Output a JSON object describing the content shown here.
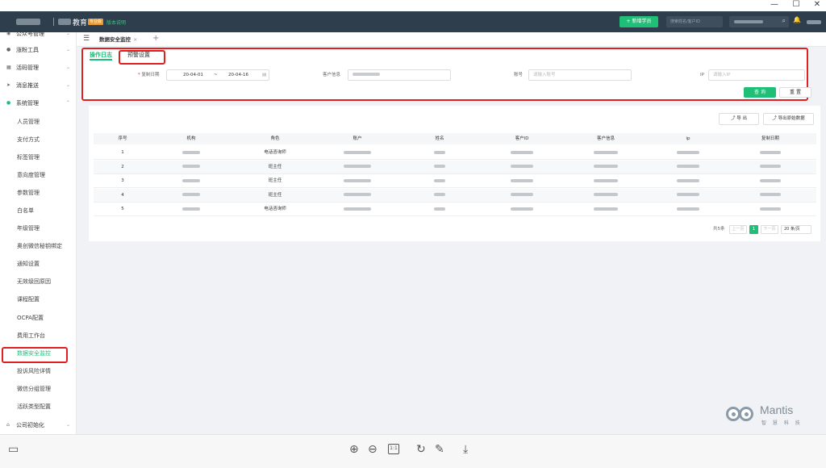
{
  "window": {
    "minimize": "—",
    "maximize": "☐",
    "close": "✕"
  },
  "topbar": {
    "brand": "教育",
    "badge": "专业版",
    "version": "版本说明",
    "add_student": "+ 新增学员",
    "search_placeholder": "搜索姓名/客户ID"
  },
  "sidebar": {
    "top_items": [
      {
        "label": "公众号管理",
        "icon": "wechat-icon"
      },
      {
        "label": "涨粉工具",
        "icon": "user-icon"
      },
      {
        "label": "活码管理",
        "icon": "grid-icon"
      },
      {
        "label": "消息推送",
        "icon": "send-icon"
      },
      {
        "label": "系统管理",
        "icon": "gear-icon"
      }
    ],
    "sub_items": [
      "人员管理",
      "支付方式",
      "标签管理",
      "意向度管理",
      "参数管理",
      "白名单",
      "年级管理",
      "奥创微信秘钥绑定",
      "通知设置",
      "无效级回原因",
      "课程配置",
      "OCPA配置",
      "费用工作台",
      "数据安全监控",
      "投诉风险详情",
      "微信分组管理",
      "活跃类型配置"
    ],
    "active_sub": "数据安全监控",
    "bottom_item": {
      "label": "公司初始化",
      "icon": "building-icon"
    }
  },
  "tabs": {
    "current": "数据安全监控",
    "close": "×",
    "add": "+"
  },
  "subtabs": [
    "操作日志",
    "预警设置"
  ],
  "filters": {
    "date_label": "复制日期",
    "date_start": "20-04-01",
    "date_sep": "~",
    "date_end": "20-04-16",
    "customer_label": "客户信息",
    "account_label": "账号",
    "account_placeholder": "请输入账号",
    "ip_label": "IP",
    "ip_placeholder": "请输入IP",
    "query": "查 询",
    "reset": "重 置"
  },
  "table": {
    "export": "导 出",
    "export_raw": "导出原始数据",
    "columns": [
      "序号",
      "机构",
      "角色",
      "账户",
      "姓名",
      "客户ID",
      "客户信息",
      "ip",
      "复制日期"
    ],
    "rows": [
      {
        "no": "1",
        "role": "电话咨询师"
      },
      {
        "no": "2",
        "role": "班主任"
      },
      {
        "no": "3",
        "role": "班主任"
      },
      {
        "no": "4",
        "role": "班主任"
      },
      {
        "no": "5",
        "role": "电话咨询师"
      }
    ]
  },
  "pagination": {
    "total": "共5条",
    "prev": "上一页",
    "page": "1",
    "next": "下一页",
    "size": "20 条/页"
  },
  "watermark": {
    "name": "Mantis",
    "sub": "智 慧 科 技"
  },
  "bottom_toolbar": {
    "zoom_reset": "1:1"
  }
}
